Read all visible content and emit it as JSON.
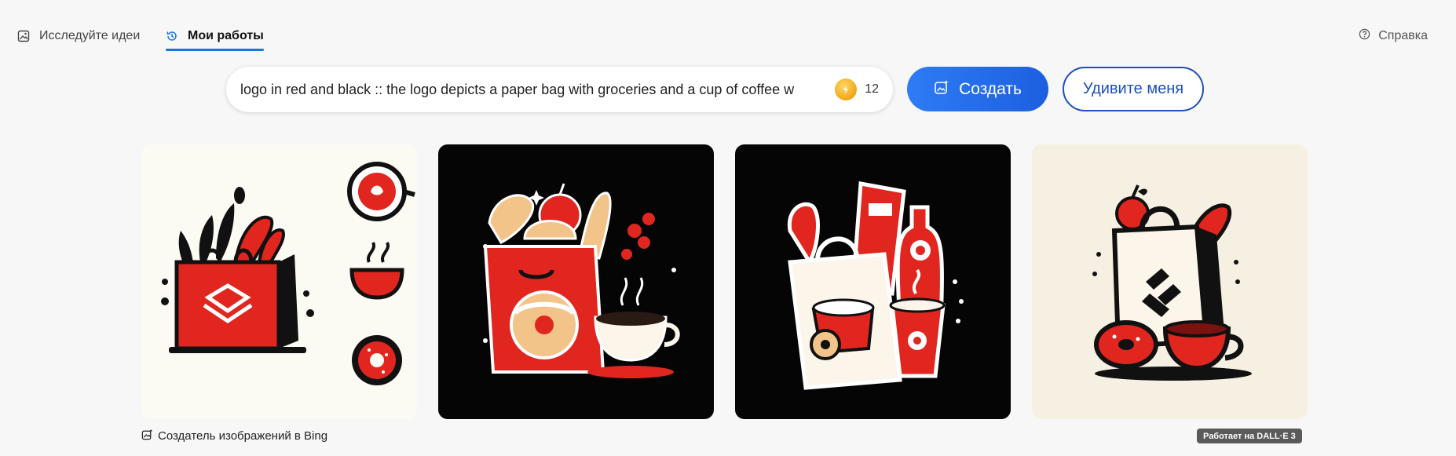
{
  "nav": {
    "explore_label": "Исследуйте идеи",
    "mywork_label": "Мои работы",
    "help_label": "Справка"
  },
  "search": {
    "value": "logo in red and black :: the logo depicts a paper bag with groceries and a cup of coffee w",
    "boosts": "12"
  },
  "buttons": {
    "create_label": "Создать",
    "surprise_label": "Удивите меня"
  },
  "footer": {
    "credit_label": "Создатель изображений в Bing",
    "powered_label": "Работает на DALL·E 3"
  },
  "colors": {
    "accent": "#1a73e8",
    "create_button": "#2267ea",
    "surprise_border": "#1c4fb8",
    "logo_red": "#e0261f",
    "logo_black": "#0a0a0a"
  },
  "gallery": {
    "count": 4
  }
}
